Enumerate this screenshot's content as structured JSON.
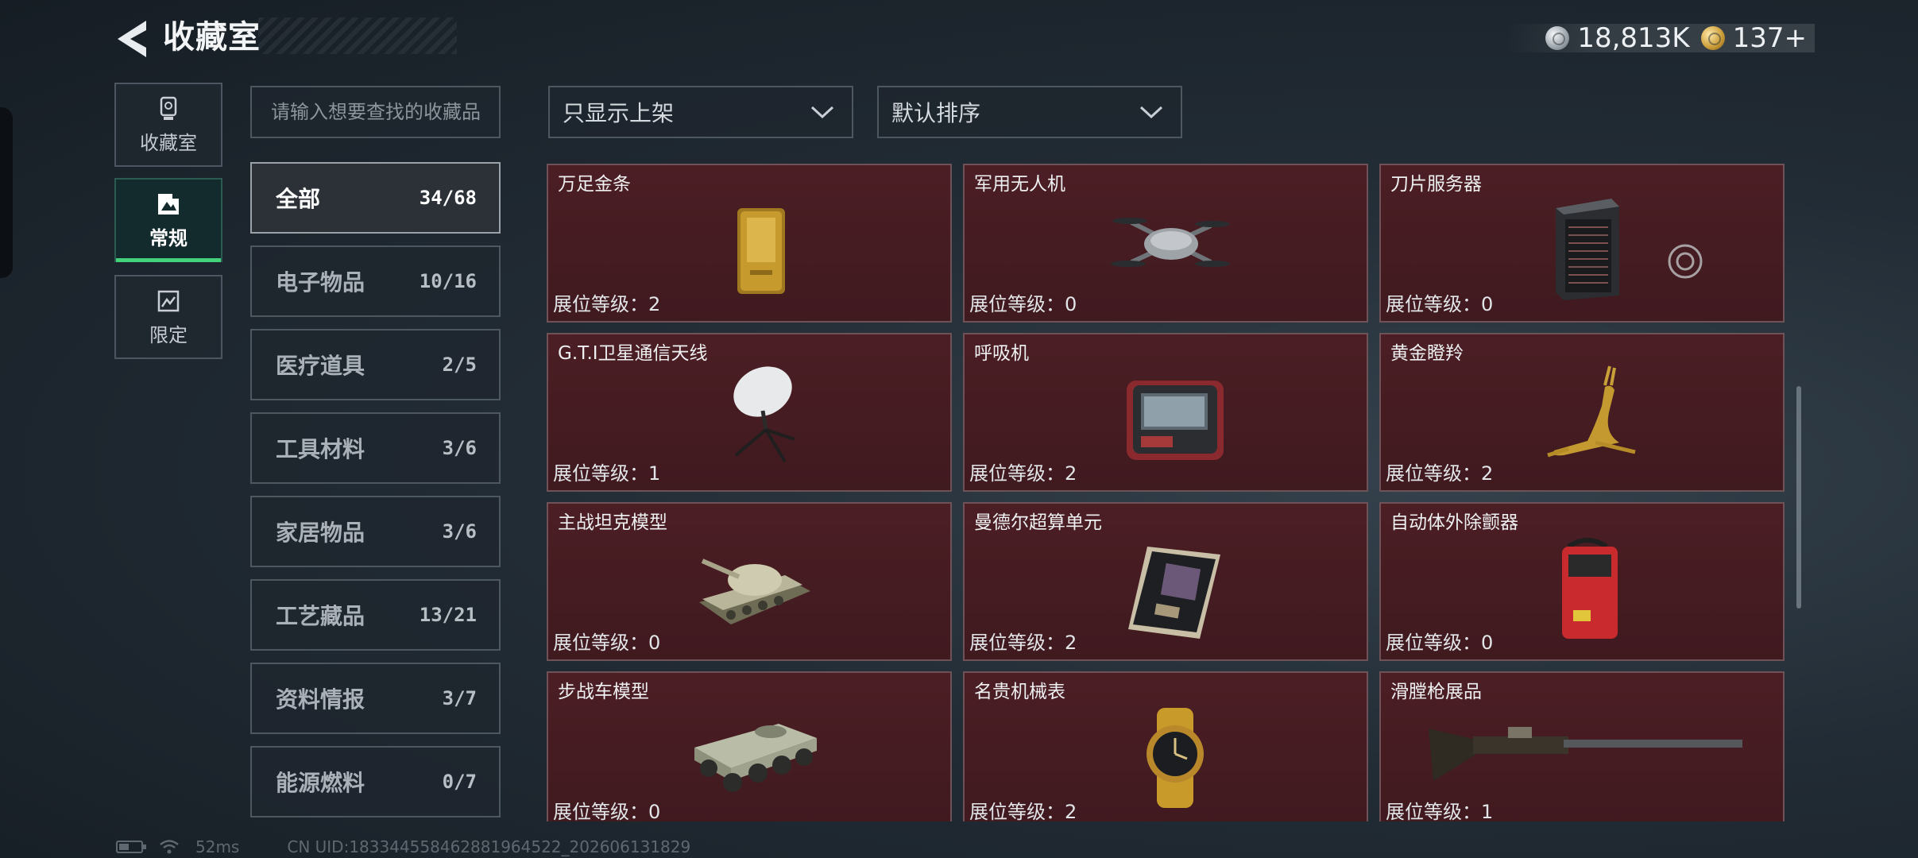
{
  "header": {
    "title": "收藏室",
    "silver": "18,813K",
    "gold": "137+"
  },
  "modes": [
    {
      "label": "收藏室",
      "icon": "trophy-icon",
      "active": false
    },
    {
      "label": "常规",
      "icon": "image-frame-icon",
      "active": true
    },
    {
      "label": "限定",
      "icon": "limited-frame-icon",
      "active": false
    }
  ],
  "search": {
    "placeholder": "请输入想要查找的收藏品"
  },
  "filters": {
    "shelf": "只显示上架",
    "sort": "默认排序"
  },
  "categories": [
    {
      "name": "全部",
      "count": "34/68",
      "active": true
    },
    {
      "name": "电子物品",
      "count": "10/16"
    },
    {
      "name": "医疗道具",
      "count": "2/5"
    },
    {
      "name": "工具材料",
      "count": "3/6"
    },
    {
      "name": "家居物品",
      "count": "3/6"
    },
    {
      "name": "工艺藏品",
      "count": "13/21"
    },
    {
      "name": "资料情报",
      "count": "3/7"
    },
    {
      "name": "能源燃料",
      "count": "0/7"
    }
  ],
  "items": [
    {
      "name": "万足金条",
      "level": "展位等级：2",
      "icon": "gold-bar-icon"
    },
    {
      "name": "军用无人机",
      "level": "展位等级：0",
      "icon": "drone-icon"
    },
    {
      "name": "刀片服务器",
      "level": "展位等级：0",
      "icon": "server-icon"
    },
    {
      "name": "G.T.I卫星通信天线",
      "level": "展位等级：1",
      "icon": "satellite-dish-icon"
    },
    {
      "name": "呼吸机",
      "level": "展位等级：2",
      "icon": "ventilator-icon"
    },
    {
      "name": "黄金瞪羚",
      "level": "展位等级：2",
      "icon": "gazelle-statue-icon"
    },
    {
      "name": "主战坦克模型",
      "level": "展位等级：0",
      "icon": "tank-model-icon"
    },
    {
      "name": "曼德尔超算单元",
      "level": "展位等级：2",
      "icon": "circuit-board-icon"
    },
    {
      "name": "自动体外除颤器",
      "level": "展位等级：0",
      "icon": "defibrillator-icon"
    },
    {
      "name": "步战车模型",
      "level": "展位等级：0",
      "icon": "ifv-model-icon"
    },
    {
      "name": "名贵机械表",
      "level": "展位等级：2",
      "icon": "watch-icon"
    },
    {
      "name": "滑膛枪展品",
      "level": "展位等级：1",
      "icon": "musket-icon"
    }
  ],
  "status": {
    "ping": "52ms",
    "uid": "CN UID:183344558462881964522_202606131829"
  }
}
